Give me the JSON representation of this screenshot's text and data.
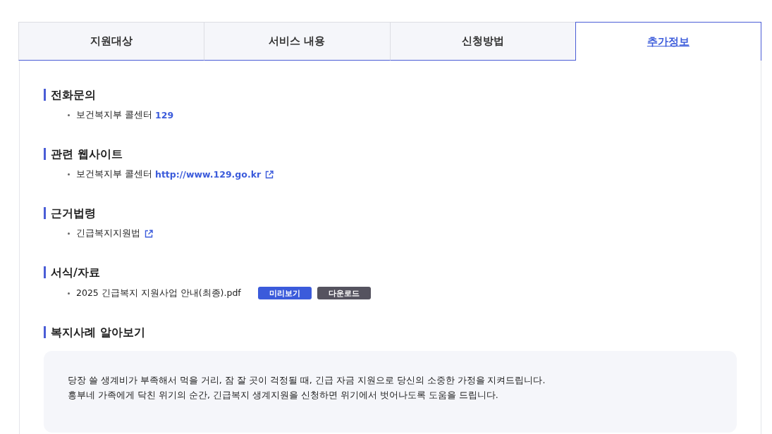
{
  "tabs": [
    {
      "label": "지원대상",
      "selected": false
    },
    {
      "label": "서비스 내용",
      "selected": false
    },
    {
      "label": "신청방법",
      "selected": false
    },
    {
      "label": "추가정보",
      "selected": true
    }
  ],
  "sections": [
    {
      "title": "전화문의",
      "items": [
        {
          "text": "보건복지부 콜센터",
          "link": "129",
          "external": false
        }
      ]
    },
    {
      "title": "관련 웹사이트",
      "items": [
        {
          "text": "보건복지부 콜센터",
          "link": "http://www.129.go.kr",
          "external": true
        }
      ]
    },
    {
      "title": "근거법령",
      "items": [
        {
          "text": "긴급복지지원법",
          "external": true
        }
      ]
    },
    {
      "title": "서식/자료",
      "items": [
        {
          "text": "2025 긴급복지 지원사업 안내(최종).pdf",
          "external": false,
          "buttons": [
            {
              "label": "미리보기",
              "kind": "preview"
            },
            {
              "label": "다운로드",
              "kind": "download"
            }
          ]
        }
      ]
    }
  ],
  "case": {
    "title": "복지사례 알아보기",
    "lines": [
      "당장 쓸 생계비가 부족해서 먹을 거리, 잠 잘 곳이 걱정될 때, 긴급 자금 지원으로 당신의 소중한 가정을 지켜드립니다.",
      "흥부네 가족에게 닥친 위기의 순간, 긴급복지 생계지원을 신청하면 위기에서 벗어나도록 도움을 드립니다."
    ]
  }
}
